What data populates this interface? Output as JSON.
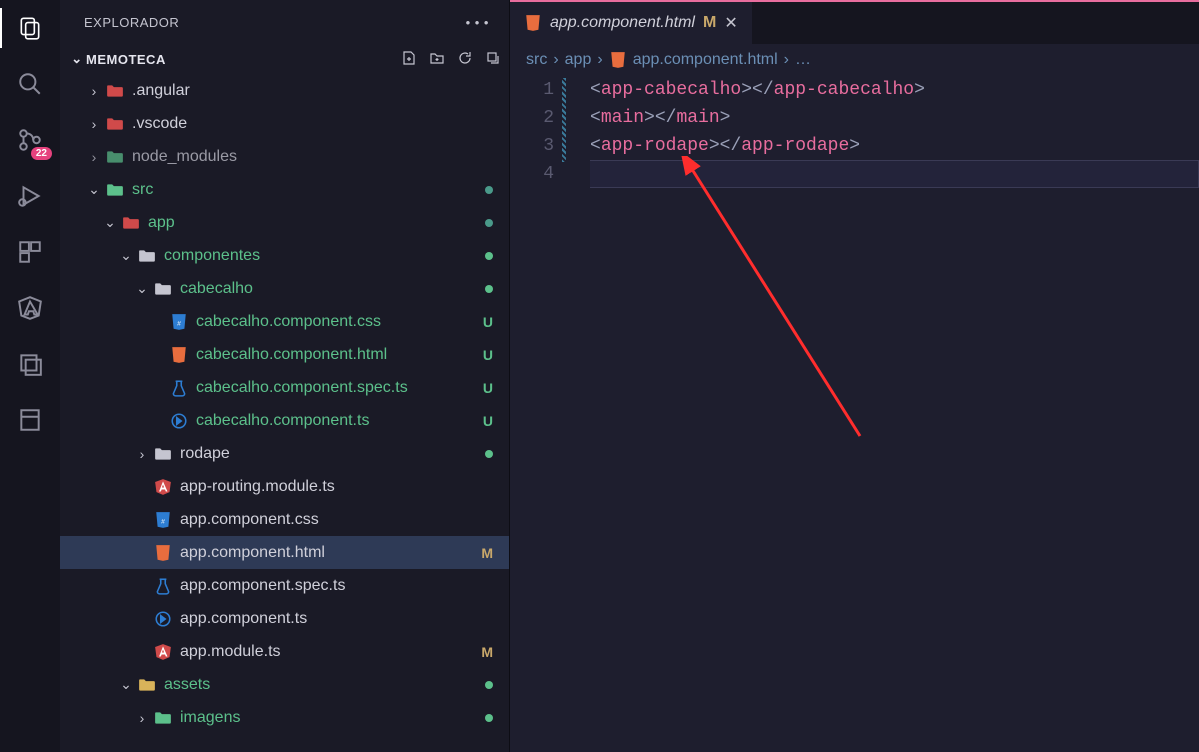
{
  "sidebar": {
    "title": "EXPLORADOR",
    "project": "MEMOTECA"
  },
  "badge": {
    "scm": "22"
  },
  "tree": [
    {
      "indent": 1,
      "type": "folder",
      "chev": "right",
      "label": ".angular",
      "iconClass": "folder-red"
    },
    {
      "indent": 1,
      "type": "folder",
      "chev": "right",
      "label": ".vscode",
      "iconClass": "folder-red"
    },
    {
      "indent": 1,
      "type": "folder",
      "chev": "right",
      "label": "node_modules",
      "iconClass": "folder-green",
      "dim": true
    },
    {
      "indent": 1,
      "type": "folder",
      "chev": "down",
      "label": "src",
      "iconClass": "folder-green",
      "green": true,
      "dot": "blue-green"
    },
    {
      "indent": 2,
      "type": "folder",
      "chev": "down",
      "label": "app",
      "iconClass": "folder-red",
      "green": true,
      "dot": "blue-green"
    },
    {
      "indent": 3,
      "type": "folder",
      "chev": "down",
      "label": "componentes",
      "iconClass": "folder-icon",
      "green": true,
      "dot": "green"
    },
    {
      "indent": 4,
      "type": "folder",
      "chev": "down",
      "label": "cabecalho",
      "iconClass": "folder-icon",
      "green": true,
      "dot": "green"
    },
    {
      "indent": 5,
      "type": "file",
      "label": "cabecalho.component.css",
      "iconClass": "file-css",
      "fileKind": "css",
      "green": true,
      "status": "U"
    },
    {
      "indent": 5,
      "type": "file",
      "label": "cabecalho.component.html",
      "iconClass": "file-html",
      "fileKind": "html",
      "green": true,
      "status": "U"
    },
    {
      "indent": 5,
      "type": "file",
      "label": "cabecalho.component.spec.ts",
      "iconClass": "file-ts",
      "fileKind": "spec",
      "green": true,
      "status": "U"
    },
    {
      "indent": 5,
      "type": "file",
      "label": "cabecalho.component.ts",
      "iconClass": "file-ts",
      "fileKind": "ts",
      "green": true,
      "status": "U"
    },
    {
      "indent": 4,
      "type": "folder",
      "chev": "right",
      "label": "rodape",
      "iconClass": "folder-icon",
      "dot": "green"
    },
    {
      "indent": 4,
      "type": "file",
      "label": "app-routing.module.ts",
      "iconClass": "file-angular",
      "fileKind": "angular"
    },
    {
      "indent": 4,
      "type": "file",
      "label": "app.component.css",
      "iconClass": "file-css",
      "fileKind": "css"
    },
    {
      "indent": 4,
      "type": "file",
      "label": "app.component.html",
      "iconClass": "file-html",
      "fileKind": "html",
      "selected": true,
      "status": "M",
      "statusClass": "m"
    },
    {
      "indent": 4,
      "type": "file",
      "label": "app.component.spec.ts",
      "iconClass": "file-ts",
      "fileKind": "spec"
    },
    {
      "indent": 4,
      "type": "file",
      "label": "app.component.ts",
      "iconClass": "file-ts",
      "fileKind": "ts"
    },
    {
      "indent": 4,
      "type": "file",
      "label": "app.module.ts",
      "iconClass": "file-angular",
      "fileKind": "angular",
      "status": "M",
      "statusClass": "m"
    },
    {
      "indent": 3,
      "type": "folder",
      "chev": "down",
      "label": "assets",
      "iconClass": "folder-yellow",
      "green": true,
      "dot": "green"
    },
    {
      "indent": 4,
      "type": "folder",
      "chev": "right",
      "label": "imagens",
      "iconClass": "folder-green",
      "green": true,
      "dot": "green"
    }
  ],
  "tab": {
    "label": "app.component.html",
    "modified": "M"
  },
  "breadcrumb": {
    "seg1": "src",
    "seg2": "app",
    "seg3": "app.component.html",
    "more": "…"
  },
  "code": {
    "lines": [
      {
        "n": "1",
        "parts": [
          {
            "t": "<",
            "c": "punct"
          },
          {
            "t": "app-cabecalho",
            "c": "tag"
          },
          {
            "t": "></",
            "c": "punct"
          },
          {
            "t": "app-cabecalho",
            "c": "tag"
          },
          {
            "t": ">",
            "c": "punct"
          }
        ]
      },
      {
        "n": "2",
        "parts": [
          {
            "t": "<",
            "c": "punct"
          },
          {
            "t": "main",
            "c": "tag"
          },
          {
            "t": "></",
            "c": "punct"
          },
          {
            "t": "main",
            "c": "tag"
          },
          {
            "t": ">",
            "c": "punct"
          }
        ]
      },
      {
        "n": "3",
        "parts": [
          {
            "t": "<",
            "c": "punct"
          },
          {
            "t": "app-rodape",
            "c": "tag"
          },
          {
            "t": "></",
            "c": "punct"
          },
          {
            "t": "app-rodape",
            "c": "tag"
          },
          {
            "t": ">",
            "c": "punct"
          }
        ]
      },
      {
        "n": "4",
        "parts": []
      }
    ]
  }
}
